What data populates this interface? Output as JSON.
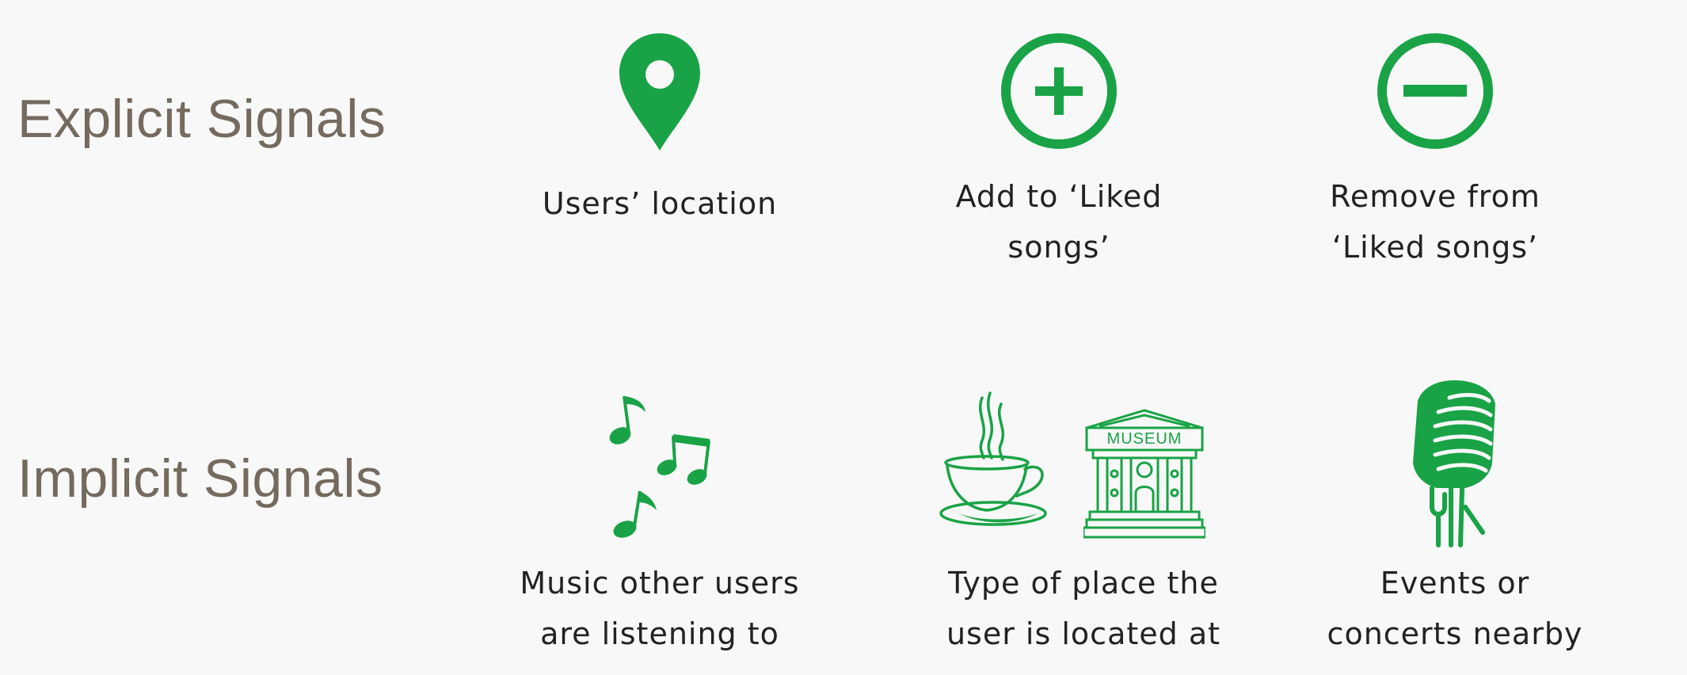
{
  "colors": {
    "accent": "#19a346",
    "heading": "#756a5e",
    "text": "#222222",
    "background": "#f8f8f8"
  },
  "explicit": {
    "title": "Explicit Signals",
    "items": [
      {
        "icon": "location-pin-icon",
        "lines": [
          "Users’ location"
        ]
      },
      {
        "icon": "plus-circle-icon",
        "lines": [
          "Add to ‘Liked",
          "songs’"
        ]
      },
      {
        "icon": "minus-circle-icon",
        "lines": [
          "Remove from",
          "‘Liked songs’"
        ]
      }
    ]
  },
  "implicit": {
    "title": "Implicit Signals",
    "items": [
      {
        "icon": "music-notes-icon",
        "lines": [
          "Music other users",
          "are listening to"
        ]
      },
      {
        "icon": "coffee-cup-icon,museum-icon",
        "museum_sign": "MUSEUM",
        "lines": [
          "Type of place the",
          "user is located at"
        ]
      },
      {
        "icon": "microphone-icon",
        "lines": [
          "Events or",
          "concerts nearby"
        ]
      }
    ]
  }
}
